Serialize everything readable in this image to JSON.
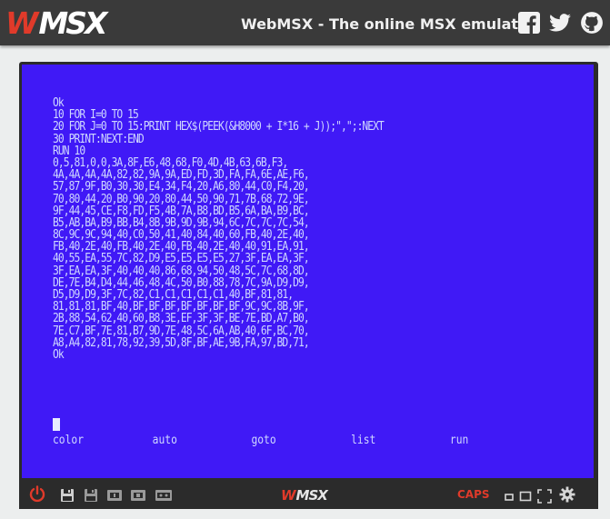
{
  "header": {
    "logo_text": "MSX",
    "title": "WebMSX - The online MSX emulator",
    "social": [
      "facebook-icon",
      "twitter-icon",
      "github-icon"
    ]
  },
  "screen": {
    "background": "#4019f6",
    "text_color": "#cfd8ff",
    "lines": [
      "Ok",
      "10 FOR I=0 TO 15",
      "20 FOR J=0 TO 15:PRINT HEX$(PEEK(&H8000 + I*16 + J));\",\";:NEXT",
      "30 PRINT:NEXT:END",
      "RUN 10",
      "0,5,81,0,0,3A,8F,E6,48,68,F0,4D,4B,63,6B,F3,",
      "4A,4A,4A,4A,82,82,9A,9A,ED,FD,3D,FA,FA,6E,AE,F6,",
      "57,87,9F,B0,30,30,E4,34,F4,20,A6,80,44,C0,F4,20,",
      "70,80,44,20,B0,90,20,80,44,50,90,71,7B,68,72,9E,",
      "9F,44,45,CE,F8,FD,F5,4B,7A,B8,BD,B5,6A,BA,B9,BC,",
      "B5,AB,BA,B9,BB,B4,8B,9B,9D,9B,94,6C,7C,7C,7C,54,",
      "8C,9C,9C,94,40,C0,50,41,40,84,40,60,FB,40,2E,40,",
      "FB,40,2E,40,FB,40,2E,40,FB,40,2E,40,40,91,EA,91,",
      "40,55,EA,55,7C,82,D9,E5,E5,E5,E5,27,3F,EA,EA,3F,",
      "3F,EA,EA,3F,40,40,40,86,68,94,50,48,5C,7C,68,8D,",
      "DE,7E,B4,D4,44,46,48,4C,50,B0,88,78,7C,9A,D9,D9,",
      "D5,D9,D9,3F,7C,82,C1,C1,C1,C1,C1,40,BF,81,81,",
      "81,81,81,BF,40,BF,BF,BF,BF,BF,BF,BF,9C,9C,8B,9F,",
      "2B,88,54,62,40,60,B8,3E,EF,3F,3F,BE,7E,BD,A7,B0,",
      "7E,C7,BF,7E,81,B7,9D,7E,48,5C,6A,AB,40,6F,BC,70,",
      "A8,A4,82,81,78,92,39,5D,8F,BF,AE,9B,FA,97,BD,71,",
      "Ok"
    ],
    "function_keys": [
      "color",
      "auto",
      "goto",
      "list",
      "run"
    ]
  },
  "controls": {
    "logo_text": "MSX",
    "caps_label": "CAPS",
    "accent_color": "#e03a2a"
  }
}
